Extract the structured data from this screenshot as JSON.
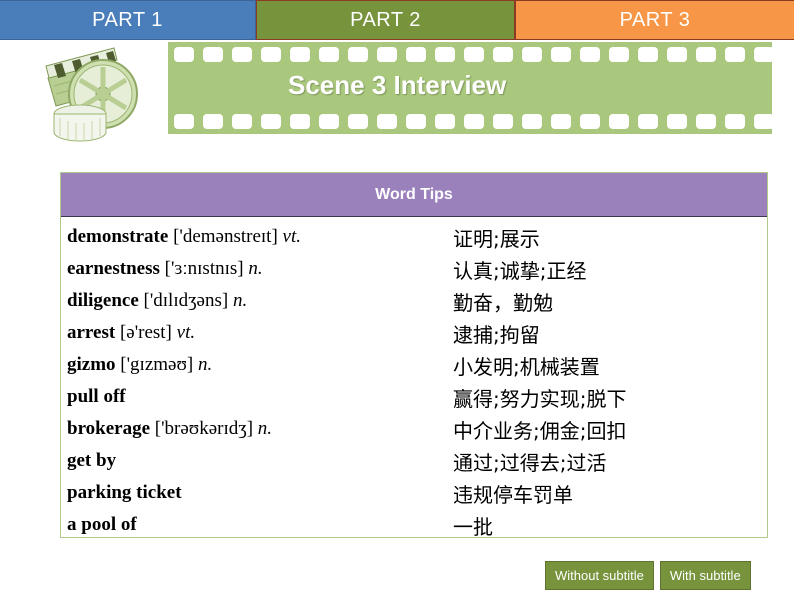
{
  "tabs": [
    {
      "label": "PART 1",
      "color": "#4a7ebb"
    },
    {
      "label": "PART 2",
      "color": "#77933c"
    },
    {
      "label": "PART 3",
      "color": "#f79646"
    }
  ],
  "banner": {
    "title": "Scene 3 Interview",
    "strip_color": "#aac77e",
    "clapper_icon": "clapperboard-icon",
    "reel_icon": "film-reel-icon"
  },
  "word_tips": {
    "header": "Word Tips",
    "header_color": "#9b81bb",
    "rows": [
      {
        "term": "demonstrate",
        "ipa": "['demənstreɪt]",
        "pos": "vt.",
        "zh": "证明;展示"
      },
      {
        "term": "earnestness",
        "ipa": "['ɜːnɪstnɪs]",
        "pos": "n.",
        "zh": "认真;诚挚;正经"
      },
      {
        "term": "diligence",
        "ipa": "['dɪlɪdʒəns]",
        "pos": "n.",
        "zh": "勤奋，勤勉"
      },
      {
        "term": "arrest",
        "ipa": "[ə'rest]",
        "pos": "vt.",
        "zh": "逮捕;拘留"
      },
      {
        "term": "gizmo",
        "ipa": "['gɪzməʊ]",
        "pos": "n.",
        "zh": "小发明;机械装置"
      },
      {
        "term": "pull off",
        "ipa": "",
        "pos": "",
        "zh": "赢得;努力实现;脱下"
      },
      {
        "term": "brokerage",
        "ipa": "['brəʊkərɪdʒ]",
        "pos": "n.",
        "zh": "中介业务;佣金;回扣"
      },
      {
        "term": "get by",
        "ipa": "",
        "pos": "",
        "zh": "通过;过得去;过活"
      },
      {
        "term": "parking ticket",
        "ipa": "",
        "pos": "",
        "zh": "违规停车罚单"
      },
      {
        "term": "a pool of",
        "ipa": "",
        "pos": "",
        "zh": "一批"
      }
    ]
  },
  "buttons": [
    {
      "label": "Without subtitle"
    },
    {
      "label": "With subtitle"
    }
  ]
}
